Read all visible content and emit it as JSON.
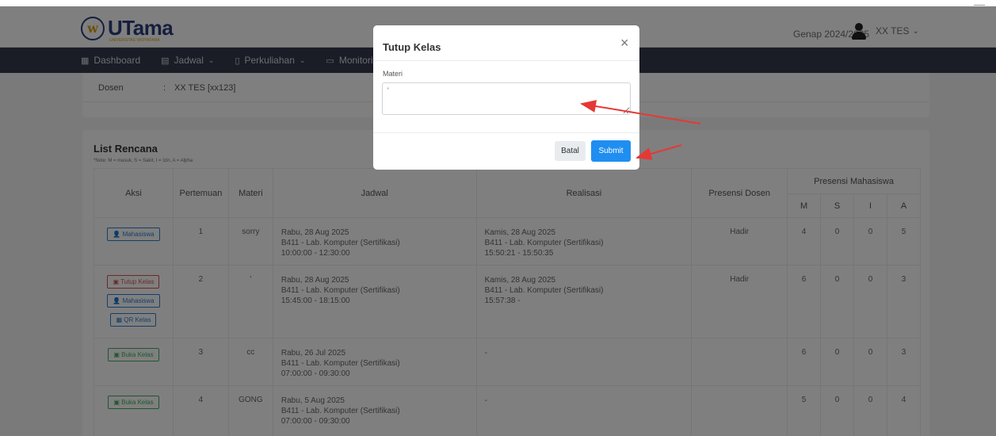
{
  "header": {
    "logo_text": "UTama",
    "logo_sub": "UNIVERSITAS WIDYATAMA",
    "semester": "Genap 2024/2025",
    "user_name": "XX TES",
    "user_chevron": "⌄"
  },
  "nav": {
    "items": [
      {
        "label": "Dashboard",
        "icon": "dashboard-icon",
        "dropdown": false
      },
      {
        "label": "Jadwal",
        "icon": "calendar-icon",
        "dropdown": true
      },
      {
        "label": "Perkuliahan",
        "icon": "book-icon",
        "dropdown": true
      },
      {
        "label": "Monitori",
        "icon": "monitor-icon",
        "dropdown": false
      }
    ]
  },
  "info": {
    "dosen_label": "Dosen",
    "dosen_colon": ":",
    "dosen_value": "XX TES [xx123]"
  },
  "list": {
    "title": "List Rencana",
    "note": "*Note: M = masuk, S = Sakit, I = Izin, A = Alpha",
    "headers": {
      "aksi": "Aksi",
      "pertemuan": "Pertemuan",
      "materi": "Materi",
      "jadwal": "Jadwal",
      "realisasi": "Realisasi",
      "presensi_dosen": "Presensi Dosen",
      "presensi_mahasiswa": "Presensi Mahasiswa",
      "m": "M",
      "s": "S",
      "i": "I",
      "a": "A"
    },
    "rows": [
      {
        "actions": [
          "Mahasiswa"
        ],
        "pertemuan": "1",
        "materi": "sorry",
        "jadwal": [
          "Rabu, 28 Aug 2025",
          "B411 - Lab. Komputer (Sertifikasi)",
          "10:00:00 - 12:30:00"
        ],
        "realisasi": [
          "Kamis, 28 Aug 2025",
          "B411 - Lab. Komputer (Sertifikasi)",
          "15:50:21 - 15:50:35"
        ],
        "presensi_dosen": "Hadir",
        "m": "4",
        "s": "0",
        "i": "0",
        "a": "5"
      },
      {
        "actions": [
          "Tutup Kelas",
          "Mahasiswa",
          "QR Kelas"
        ],
        "pertemuan": "2",
        "materi": "'",
        "jadwal": [
          "Rabu, 28 Aug 2025",
          "B411 - Lab. Komputer (Sertifikasi)",
          "15:45:00 - 18:15:00"
        ],
        "realisasi": [
          "Kamis, 28 Aug 2025",
          "B411 - Lab. Komputer (Sertifikasi)",
          "15:57:38 -"
        ],
        "presensi_dosen": "Hadir",
        "m": "6",
        "s": "0",
        "i": "0",
        "a": "3"
      },
      {
        "actions": [
          "Buka Kelas"
        ],
        "pertemuan": "3",
        "materi": "cc",
        "jadwal": [
          "Rabu, 26 Jul 2025",
          "B411 - Lab. Komputer (Sertifikasi)",
          "07:00:00 - 09:30:00"
        ],
        "realisasi": [
          "-"
        ],
        "presensi_dosen": "",
        "m": "6",
        "s": "0",
        "i": "0",
        "a": "3"
      },
      {
        "actions": [
          "Buka Kelas"
        ],
        "pertemuan": "4",
        "materi": "GONG",
        "jadwal": [
          "Rabu, 5 Aug 2025",
          "B411 - Lab. Komputer (Sertifikasi)",
          "07:00:00 - 09:30:00"
        ],
        "realisasi": [
          "-"
        ],
        "presensi_dosen": "",
        "m": "5",
        "s": "0",
        "i": "0",
        "a": "4"
      }
    ]
  },
  "modal": {
    "title": "Tutup Kelas",
    "close": "×",
    "materi_label": "Materi",
    "materi_value": "'",
    "batal_label": "Batal",
    "submit_label": "Submit"
  },
  "colors": {
    "navbar": "#343a4c",
    "primary": "#1f8ef1",
    "danger": "#d9534f",
    "success": "#3fae5a",
    "annotation_arrow": "#e53935"
  }
}
